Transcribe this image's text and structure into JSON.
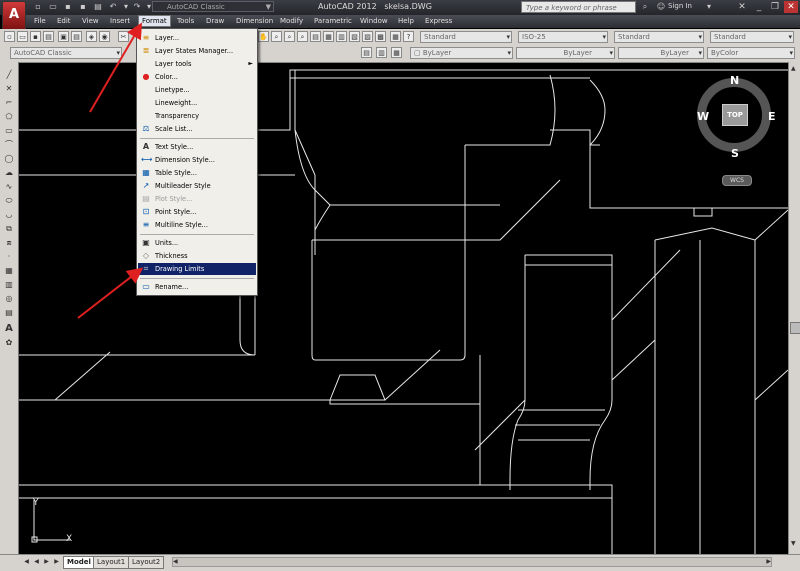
{
  "app": {
    "logo_letter": "A",
    "title": "AutoCAD 2012",
    "file": "skelsa.DWG",
    "workspace": "AutoCAD Classic",
    "search_placeholder": "Type a keyword or phrase",
    "sign_in": "Sign In"
  },
  "menubar": {
    "items": [
      "File",
      "Edit",
      "View",
      "Insert",
      "Format",
      "Tools",
      "Draw",
      "Dimension",
      "Modify",
      "Parametric",
      "Window",
      "Help",
      "Express"
    ]
  },
  "toolbar2": {
    "workspace": "AutoCAD Classic",
    "layer": "ByLayer",
    "linetype": "ByLayer",
    "lineweight": "ByLayer",
    "color": "ByColor",
    "text_style": "Standard",
    "dim_style": "ISO-25",
    "table_style": "Standard",
    "mleader_style": "Standard"
  },
  "format_menu": {
    "items": [
      {
        "label": "Layer...",
        "icon": "layer-icon"
      },
      {
        "label": "Layer States Manager...",
        "icon": "layer-states-icon"
      },
      {
        "label": "Layer tools",
        "icon": "",
        "submenu": "►"
      },
      {
        "label": "Color...",
        "icon": "color-wheel-icon"
      },
      {
        "label": "Linetype...",
        "icon": ""
      },
      {
        "label": "Lineweight...",
        "icon": ""
      },
      {
        "label": "Transparency",
        "icon": ""
      },
      {
        "label": "Scale List...",
        "icon": "scale-list-icon"
      },
      {
        "label": "Text Style...",
        "icon": "text-style-icon"
      },
      {
        "label": "Dimension Style...",
        "icon": "dimension-style-icon"
      },
      {
        "label": "Table Style...",
        "icon": "table-style-icon"
      },
      {
        "label": "Multileader Style",
        "icon": "multileader-icon"
      },
      {
        "label": "Plot Style...",
        "icon": "plot-style-icon",
        "disabled": true
      },
      {
        "label": "Point Style...",
        "icon": "point-style-icon"
      },
      {
        "label": "Multiline Style...",
        "icon": "multiline-icon"
      },
      {
        "label": "Units...",
        "icon": "units-icon"
      },
      {
        "label": "Thickness",
        "icon": "thickness-icon"
      },
      {
        "label": "Drawing Limits",
        "icon": "drawing-limits-icon",
        "highlighted": true
      },
      {
        "label": "Rename...",
        "icon": "rename-icon"
      }
    ]
  },
  "viewcube": {
    "north": "N",
    "south": "S",
    "east": "E",
    "west": "W",
    "top": "TOP",
    "wcs": "WCS"
  },
  "ucs": {
    "x": "X",
    "y": "Y"
  },
  "layout_tabs": [
    "Model",
    "Layout1",
    "Layout2"
  ],
  "colors": {
    "canvas": "#000000",
    "ui": "#d6d3ce",
    "highlight": "#0f2366",
    "annotation": "#e02020"
  }
}
